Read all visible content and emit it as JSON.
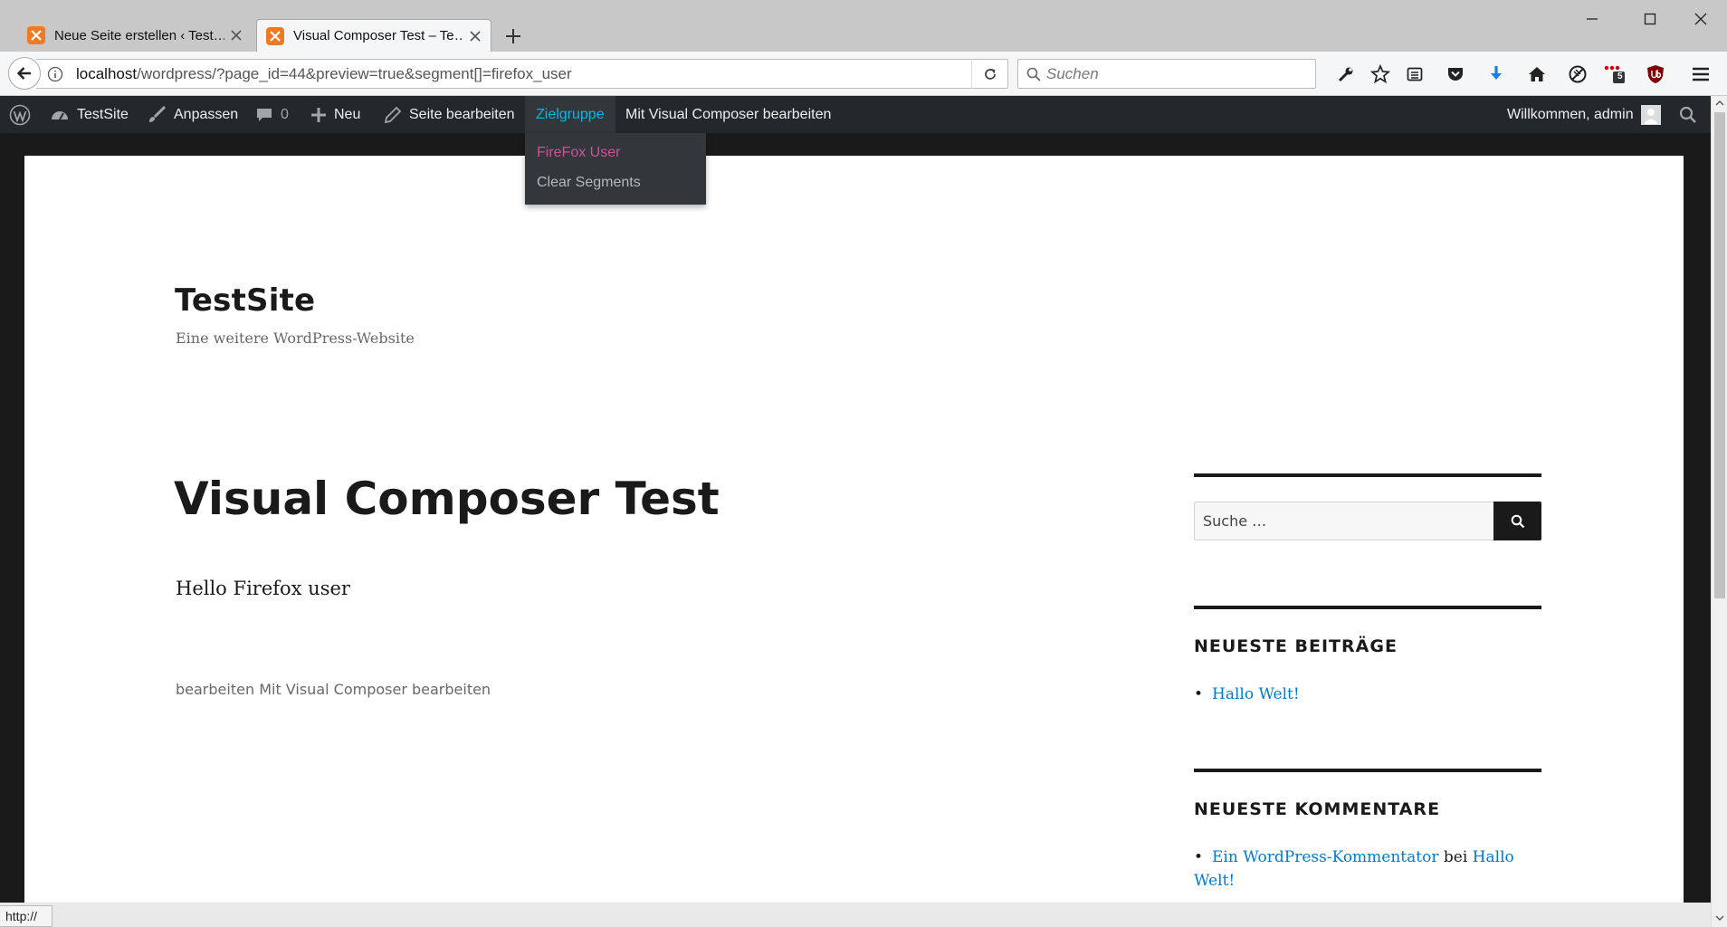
{
  "browser": {
    "tabs": [
      {
        "title": "Neue Seite erstellen ‹ Test…",
        "active": false
      },
      {
        "title": "Visual Composer Test – Te…",
        "active": true
      }
    ],
    "url_host": "localhost",
    "url_rest": "/wordpress/?page_id=44&preview=true&segment[]=firefox_user",
    "search_placeholder": "Suchen",
    "status_text": "http://",
    "addon_badge": "5"
  },
  "adminbar": {
    "site_name": "TestSite",
    "customize": "Anpassen",
    "comments_count": "0",
    "new": "Neu",
    "edit_page": "Seite bearbeiten",
    "target_group": "Zielgruppe",
    "vc_edit": "Mit Visual Composer bearbeiten",
    "welcome": "Willkommen, admin",
    "submenu": {
      "firefox_user": "FireFox User",
      "clear_segments": "Clear Segments"
    }
  },
  "site": {
    "title": "TestSite",
    "description": "Eine weitere WordPress-Website"
  },
  "entry": {
    "title": "Visual Composer Test",
    "content": "Hello Firefox user",
    "footer_edit": "bearbeiten",
    "footer_vc": "Mit Visual Composer bearbeiten"
  },
  "sidebar": {
    "search_placeholder": "Suche …",
    "recent_posts_title": "NEUESTE BEITRÄGE",
    "recent_posts": [
      "Hallo Welt!"
    ],
    "recent_comments_title": "NEUESTE KOMMENTARE",
    "comment_author": "Ein WordPress-Kommentator",
    "comment_connector": "bei",
    "comment_post": "Hallo Welt!"
  },
  "colors": {
    "adminbar_bg": "#23282d",
    "adminbar_hover": "#00b9eb",
    "submenu_active": "#d54e9c",
    "link": "#007acc",
    "tab_favicon": "#ef7a22"
  }
}
